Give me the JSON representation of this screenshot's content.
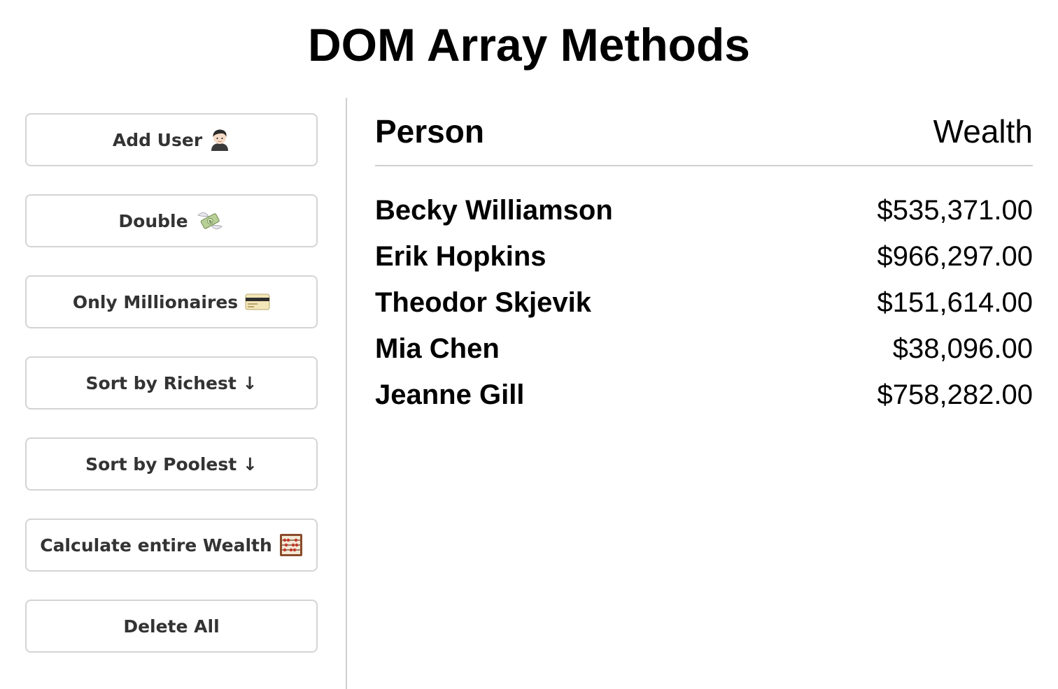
{
  "title": "DOM Array Methods",
  "buttons": [
    {
      "label": "Add User",
      "icon": "person-emoji-icon"
    },
    {
      "label": "Double",
      "icon": "money-with-wings-icon"
    },
    {
      "label": "Only Millionaires",
      "icon": "credit-card-icon"
    },
    {
      "label": "Sort by Richest ↓",
      "icon": ""
    },
    {
      "label": "Sort by Poolest ↓",
      "icon": ""
    },
    {
      "label": "Calculate entire Wealth",
      "icon": "abacus-icon"
    },
    {
      "label": "Delete All",
      "icon": ""
    }
  ],
  "table": {
    "person_header": "Person",
    "wealth_header": "Wealth",
    "rows": [
      {
        "name": "Becky Williamson",
        "wealth": "$535,371.00"
      },
      {
        "name": "Erik Hopkins",
        "wealth": "$966,297.00"
      },
      {
        "name": "Theodor Skjevik",
        "wealth": "$151,614.00"
      },
      {
        "name": "Mia Chen",
        "wealth": "$38,096.00"
      },
      {
        "name": "Jeanne Gill",
        "wealth": "$758,282.00"
      }
    ]
  }
}
